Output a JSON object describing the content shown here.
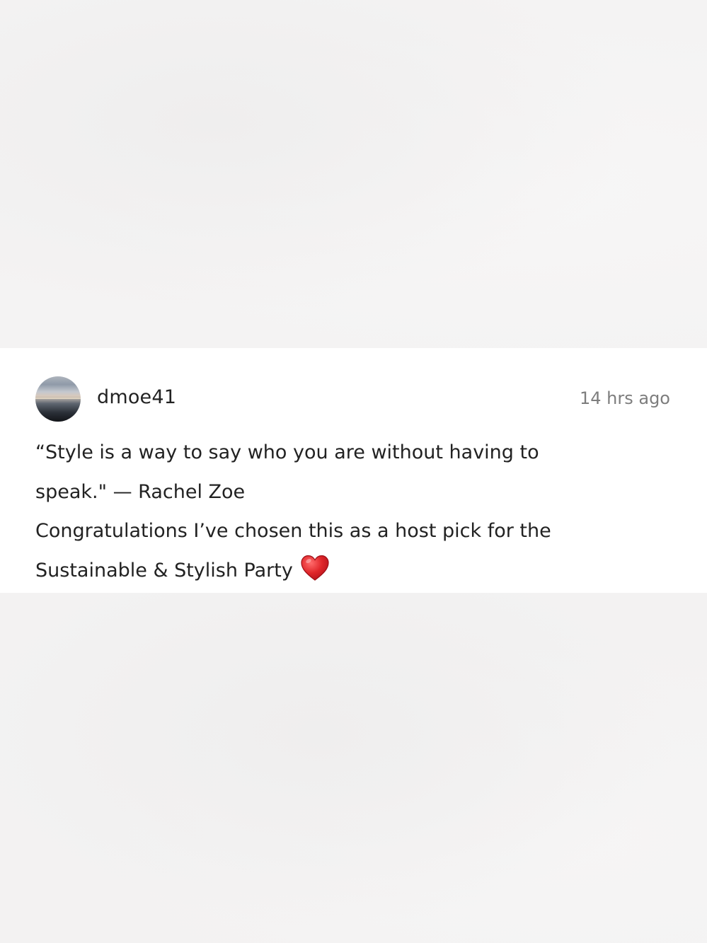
{
  "comment": {
    "username": "dmoe41",
    "timestamp": "14 hrs ago",
    "lines": [
      "“Style is a way to say who you are without having to",
      "speak.\" — Rachel Zoe",
      "Congratulations I’ve chosen this as a host pick for the",
      "Sustainable & Stylish Party"
    ],
    "emoji": "red-heart-icon"
  },
  "colors": {
    "heart": "#e0262a",
    "text": "#222222",
    "timestamp": "#7d7d7d",
    "card_background": "#ffffff",
    "page_background": "#f3f2f2"
  }
}
